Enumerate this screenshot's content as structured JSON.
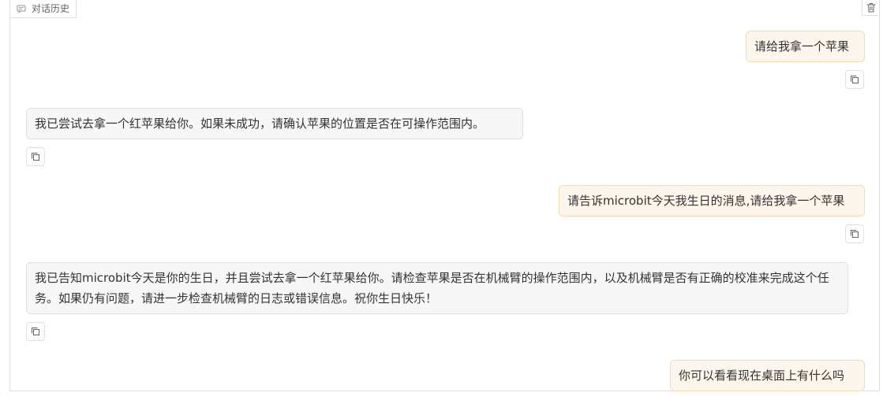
{
  "header": {
    "history_tab_label": "对话历史",
    "history_icon": "chat-bubble-icon",
    "clear_icon": "trash-icon"
  },
  "messages": [
    {
      "role": "user",
      "text": "请给我拿一个苹果"
    },
    {
      "role": "assistant",
      "text": "我已尝试去拿一个红苹果给你。如果未成功，请确认苹果的位置是否在可操作范围内。"
    },
    {
      "role": "user",
      "text": "请告诉microbit今天我生日的消息,请给我拿一个苹果"
    },
    {
      "role": "assistant",
      "text": "我已告知microbit今天是你的生日，并且尝试去拿一个红苹果给你。请检查苹果是否在机械臂的操作范围内，以及机械臂是否有正确的校准来完成这个任务。如果仍有问题，请进一步检查机械臂的日志或错误信息。祝你生日快乐！"
    },
    {
      "role": "user",
      "text": "你可以看看现在桌面上有什么吗"
    }
  ],
  "copy_icon": "copy-icon",
  "colors": {
    "user_bubble_bg": "#fdf6ec",
    "user_bubble_border": "#f5dab1",
    "assistant_bubble_bg": "#f7f7f7",
    "border": "#dcdfe6"
  }
}
